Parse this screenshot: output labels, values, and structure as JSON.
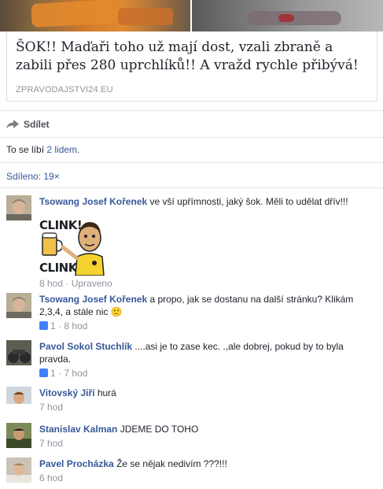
{
  "post": {
    "link_title": "ŠOK!! Maďaři toho už mají dost, vzali zbraně a zabili přes 280 uprchlíků!! A vražd rychle přibývá!",
    "link_domain": "ZPRAVODAJSTVI24.EU",
    "share_label": "Sdílet",
    "likes_prefix": "To se líbí ",
    "likes_link": "2 lidem",
    "likes_suffix": ".",
    "shares_text": "Sdíleno: 19×"
  },
  "sticker": {
    "top_text": "CLINK!",
    "bottom_text": "CLINK!"
  },
  "comments": [
    {
      "name": "Tsowang Josef Kořenek",
      "text": " ve vší upřímnosti, jaký šok. Měli to udělat dřív!!!",
      "meta": "8 hod · Upraveno"
    },
    {
      "name": "Tsowang Josef Kořenek",
      "text": " a propo, jak se dostanu na další stránku? Klikám 2,3,4, a stále nic 🙁",
      "likes": "1",
      "meta": " · 8 hod"
    },
    {
      "name": "Pavol Sokol Stuchlík",
      "text": " ....asi je to zase kec. .,ale dobrej, pokud by to byla pravda.",
      "likes": "1",
      "meta": " · 7 hod"
    },
    {
      "name": "Vitovský Jiří",
      "text": " hurá",
      "meta": "7 hod"
    },
    {
      "name": "Stanislav Kalman",
      "text": " JDEME DO TOHO",
      "meta": "7 hod"
    },
    {
      "name": "Pavel Procházka",
      "text": " Že se nějak nedivím ???!!!",
      "meta": "6 hod"
    }
  ],
  "colors": {
    "link": "#365899",
    "meta": "#90949c",
    "text": "#1d2129",
    "like_icon": "#4080ff"
  }
}
